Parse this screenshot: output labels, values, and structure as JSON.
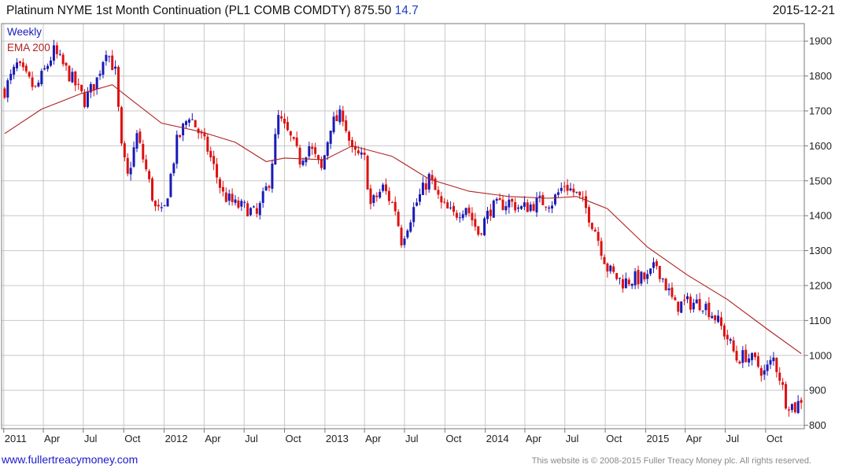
{
  "header": {
    "title": "Platinum NYME 1st Month Continuation (PL1 COMB COMDTY) 875.50",
    "change": "14.7",
    "date": "2015-12-21"
  },
  "footer": {
    "url": "www.fullertreacymoney.com",
    "copyright": "This website is © 2008-2015 Fuller Treacy Money plc. All rights reserved."
  },
  "colors": {
    "up": "#1a1ab8",
    "down": "#dd1111",
    "ema": "#b02020",
    "grid": "#c8c8c8"
  },
  "chart_data": {
    "type": "candlestick",
    "legend": [
      {
        "label": "Weekly",
        "color": "#1a1ab8"
      },
      {
        "label": "EMA 200",
        "color": "#b02020"
      }
    ],
    "y_range": [
      790,
      1950
    ],
    "y_ticks": [
      800,
      900,
      1000,
      1100,
      1200,
      1300,
      1400,
      1500,
      1600,
      1700,
      1800,
      1900
    ],
    "x_range": [
      "2010-12-27",
      "2015-12-28"
    ],
    "x_ticks": [
      {
        "label": "2011",
        "date": "2011-01-01"
      },
      {
        "label": "Apr",
        "date": "2011-04-01"
      },
      {
        "label": "Jul",
        "date": "2011-07-01"
      },
      {
        "label": "Oct",
        "date": "2011-10-01"
      },
      {
        "label": "2012",
        "date": "2012-01-01"
      },
      {
        "label": "Apr",
        "date": "2012-04-01"
      },
      {
        "label": "Jul",
        "date": "2012-07-01"
      },
      {
        "label": "Oct",
        "date": "2012-10-01"
      },
      {
        "label": "2013",
        "date": "2013-01-01"
      },
      {
        "label": "Apr",
        "date": "2013-04-01"
      },
      {
        "label": "Jul",
        "date": "2013-07-01"
      },
      {
        "label": "Oct",
        "date": "2013-10-01"
      },
      {
        "label": "2014",
        "date": "2014-01-01"
      },
      {
        "label": "Apr",
        "date": "2014-04-01"
      },
      {
        "label": "Jul",
        "date": "2014-07-01"
      },
      {
        "label": "Oct",
        "date": "2014-10-01"
      },
      {
        "label": "2015",
        "date": "2015-01-01"
      },
      {
        "label": "Apr",
        "date": "2015-04-01"
      },
      {
        "label": "Jul",
        "date": "2015-07-01"
      },
      {
        "label": "Oct",
        "date": "2015-10-01"
      }
    ],
    "close_path": [
      [
        "2011-01-03",
        1760
      ],
      [
        "2011-01-31",
        1830
      ],
      [
        "2011-03-14",
        1760
      ],
      [
        "2011-04-25",
        1870
      ],
      [
        "2011-06-06",
        1790
      ],
      [
        "2011-07-04",
        1730
      ],
      [
        "2011-08-01",
        1790
      ],
      [
        "2011-08-22",
        1880
      ],
      [
        "2011-09-12",
        1810
      ],
      [
        "2011-09-26",
        1590
      ],
      [
        "2011-10-10",
        1510
      ],
      [
        "2011-10-31",
        1630
      ],
      [
        "2011-11-21",
        1530
      ],
      [
        "2011-12-12",
        1420
      ],
      [
        "2011-12-30",
        1400
      ],
      [
        "2012-01-30",
        1610
      ],
      [
        "2012-02-27",
        1690
      ],
      [
        "2012-04-09",
        1590
      ],
      [
        "2012-05-14",
        1460
      ],
      [
        "2012-06-11",
        1430
      ],
      [
        "2012-07-09",
        1420
      ],
      [
        "2012-07-30",
        1400
      ],
      [
        "2012-08-27",
        1500
      ],
      [
        "2012-09-17",
        1680
      ],
      [
        "2012-10-15",
        1620
      ],
      [
        "2012-11-05",
        1560
      ],
      [
        "2012-11-26",
        1600
      ],
      [
        "2012-12-24",
        1530
      ],
      [
        "2013-01-14",
        1660
      ],
      [
        "2013-02-11",
        1690
      ],
      [
        "2013-03-04",
        1580
      ],
      [
        "2013-04-01",
        1560
      ],
      [
        "2013-04-15",
        1430
      ],
      [
        "2013-05-13",
        1480
      ],
      [
        "2013-06-10",
        1420
      ],
      [
        "2013-06-24",
        1330
      ],
      [
        "2013-07-22",
        1420
      ],
      [
        "2013-08-26",
        1510
      ],
      [
        "2013-09-23",
        1430
      ],
      [
        "2013-10-21",
        1400
      ],
      [
        "2013-11-18",
        1430
      ],
      [
        "2013-12-16",
        1350
      ],
      [
        "2014-01-13",
        1420
      ],
      [
        "2014-02-24",
        1440
      ],
      [
        "2014-03-24",
        1420
      ],
      [
        "2014-05-05",
        1440
      ],
      [
        "2014-06-02",
        1440
      ],
      [
        "2014-06-30",
        1490
      ],
      [
        "2014-07-28",
        1460
      ],
      [
        "2014-08-18",
        1420
      ],
      [
        "2014-09-08",
        1360
      ],
      [
        "2014-10-06",
        1250
      ],
      [
        "2014-10-20",
        1230
      ],
      [
        "2014-11-10",
        1210
      ],
      [
        "2014-12-08",
        1220
      ],
      [
        "2015-01-05",
        1220
      ],
      [
        "2015-01-26",
        1260
      ],
      [
        "2015-02-16",
        1200
      ],
      [
        "2015-03-09",
        1140
      ],
      [
        "2015-03-30",
        1150
      ],
      [
        "2015-04-20",
        1150
      ],
      [
        "2015-05-11",
        1150
      ],
      [
        "2015-06-08",
        1110
      ],
      [
        "2015-07-06",
        1050
      ],
      [
        "2015-07-27",
        990
      ],
      [
        "2015-08-17",
        1000
      ],
      [
        "2015-09-07",
        980
      ],
      [
        "2015-09-28",
        950
      ],
      [
        "2015-10-19",
        990
      ],
      [
        "2015-11-02",
        940
      ],
      [
        "2015-11-16",
        870
      ],
      [
        "2015-12-07",
        850
      ],
      [
        "2015-12-21",
        876
      ]
    ],
    "ema_200": [
      [
        "2011-01-03",
        1635
      ],
      [
        "2011-03-28",
        1705
      ],
      [
        "2011-06-27",
        1750
      ],
      [
        "2011-09-05",
        1775
      ],
      [
        "2011-10-10",
        1740
      ],
      [
        "2011-12-26",
        1665
      ],
      [
        "2012-03-26",
        1640
      ],
      [
        "2012-06-11",
        1610
      ],
      [
        "2012-08-20",
        1555
      ],
      [
        "2012-10-01",
        1565
      ],
      [
        "2012-12-31",
        1560
      ],
      [
        "2013-03-04",
        1600
      ],
      [
        "2013-06-03",
        1570
      ],
      [
        "2013-08-26",
        1505
      ],
      [
        "2013-11-25",
        1470
      ],
      [
        "2014-02-24",
        1455
      ],
      [
        "2014-05-26",
        1450
      ],
      [
        "2014-07-28",
        1455
      ],
      [
        "2014-10-06",
        1420
      ],
      [
        "2015-01-05",
        1310
      ],
      [
        "2015-04-06",
        1230
      ],
      [
        "2015-07-06",
        1160
      ],
      [
        "2015-10-05",
        1075
      ],
      [
        "2015-12-21",
        1005
      ]
    ]
  }
}
